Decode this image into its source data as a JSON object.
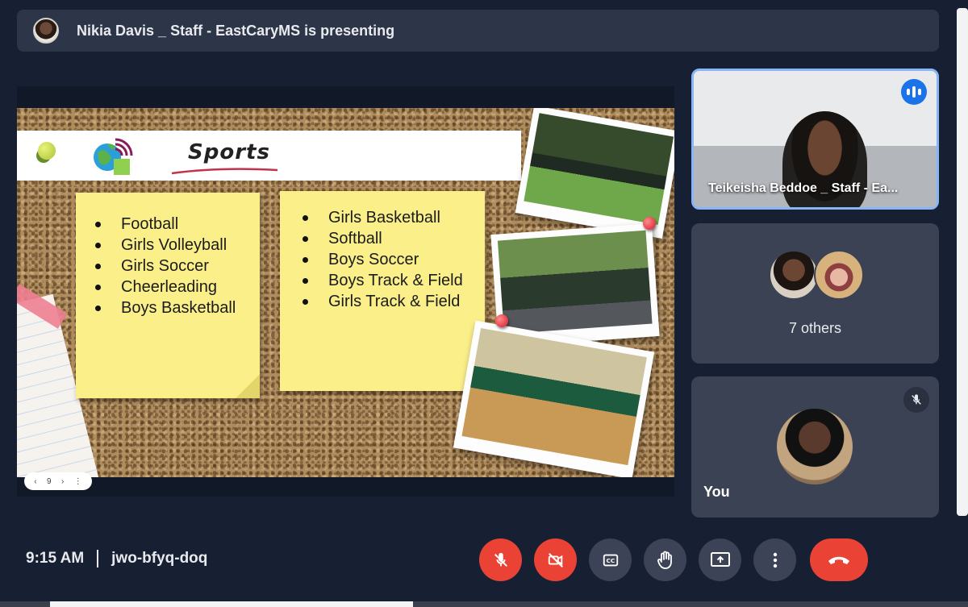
{
  "presenting": {
    "text": "Nikia Davis _ Staff - EastCaryMS is presenting"
  },
  "slide": {
    "title": "Sports",
    "list_left": [
      "Football",
      "Girls Volleyball",
      "Girls Soccer",
      "Cheerleading",
      "Boys Basketball"
    ],
    "list_right": [
      "Girls Basketball",
      "Softball",
      "Boys Soccer",
      "Boys Track & Field",
      "Girls Track & Field"
    ],
    "page_number": "9"
  },
  "participants": {
    "speaker_name": "Teikeisha Beddoe _ Staff - Ea...",
    "others_label": "7 others",
    "you_label": "You"
  },
  "footer": {
    "time": "9:15 AM",
    "meeting_code": "jwo-bfyq-doq"
  },
  "icons": {
    "audio": "audio-level-icon",
    "mic_off": "mic-off-icon",
    "camera_off": "camera-off-icon",
    "captions": "captions-icon",
    "raise_hand": "raise-hand-icon",
    "present": "present-screen-icon",
    "more": "more-vert-icon",
    "leave": "call-end-icon"
  },
  "colors": {
    "background": "#172033",
    "tile": "#3a4254",
    "danger": "#ea4335",
    "active_border": "#8ab4f8"
  }
}
